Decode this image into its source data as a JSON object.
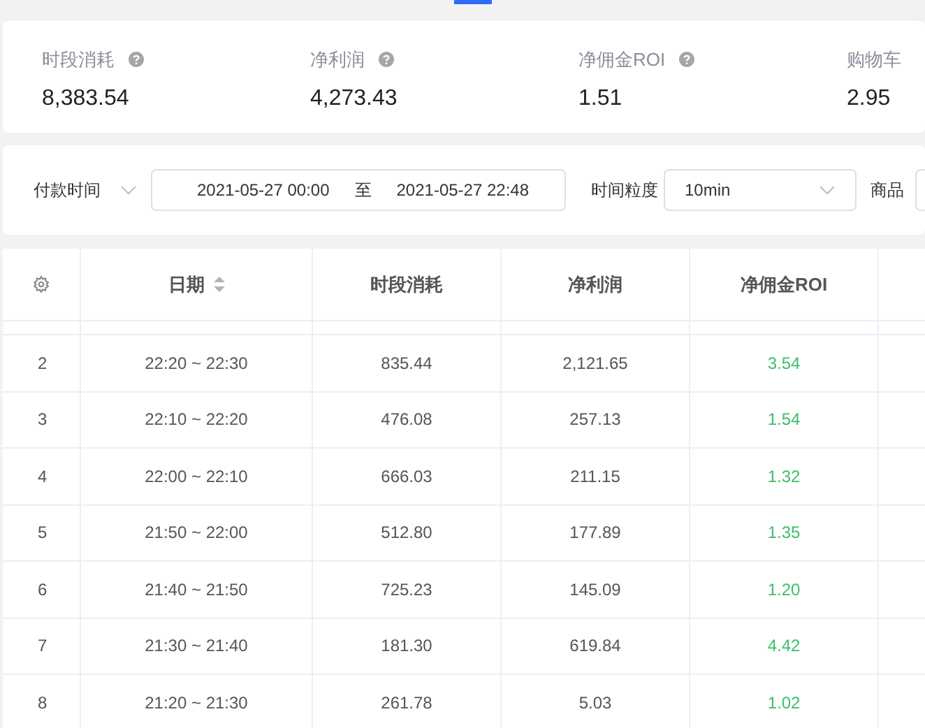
{
  "stats": [
    {
      "label": "时段消耗",
      "value": "8,383.54",
      "help": true
    },
    {
      "label": "净利润",
      "value": "4,273.43",
      "help": true
    },
    {
      "label": "净佣金ROI",
      "value": "1.51",
      "help": true
    },
    {
      "label": "购物车",
      "value": "2.95",
      "help": false
    }
  ],
  "filters": {
    "time_type": "付款时间",
    "date_start": "2021-05-27 00:00",
    "date_sep": "至",
    "date_end": "2021-05-27 22:48",
    "granularity_label": "时间粒度",
    "granularity": "10min",
    "product_label": "商品"
  },
  "table": {
    "columns": [
      {
        "label": "日期",
        "sortable": true
      },
      {
        "label": "时段消耗",
        "sortable": false
      },
      {
        "label": "净利润",
        "sortable": false
      },
      {
        "label": "净佣金ROI",
        "sortable": false
      }
    ],
    "rows": [
      {
        "index": "2",
        "period": "22:20 ~ 22:30",
        "spend": "835.44",
        "profit": "2,121.65",
        "roi": "3.54"
      },
      {
        "index": "3",
        "period": "22:10 ~ 22:20",
        "spend": "476.08",
        "profit": "257.13",
        "roi": "1.54"
      },
      {
        "index": "4",
        "period": "22:00 ~ 22:10",
        "spend": "666.03",
        "profit": "211.15",
        "roi": "1.32"
      },
      {
        "index": "5",
        "period": "21:50 ~ 22:00",
        "spend": "512.80",
        "profit": "177.89",
        "roi": "1.35"
      },
      {
        "index": "6",
        "period": "21:40 ~ 21:50",
        "spend": "725.23",
        "profit": "145.09",
        "roi": "1.20"
      },
      {
        "index": "7",
        "period": "21:30 ~ 21:40",
        "spend": "181.30",
        "profit": "619.84",
        "roi": "4.42"
      },
      {
        "index": "8",
        "period": "21:20 ~ 21:30",
        "spend": "261.78",
        "profit": "5.03",
        "roi": "1.02"
      }
    ]
  }
}
